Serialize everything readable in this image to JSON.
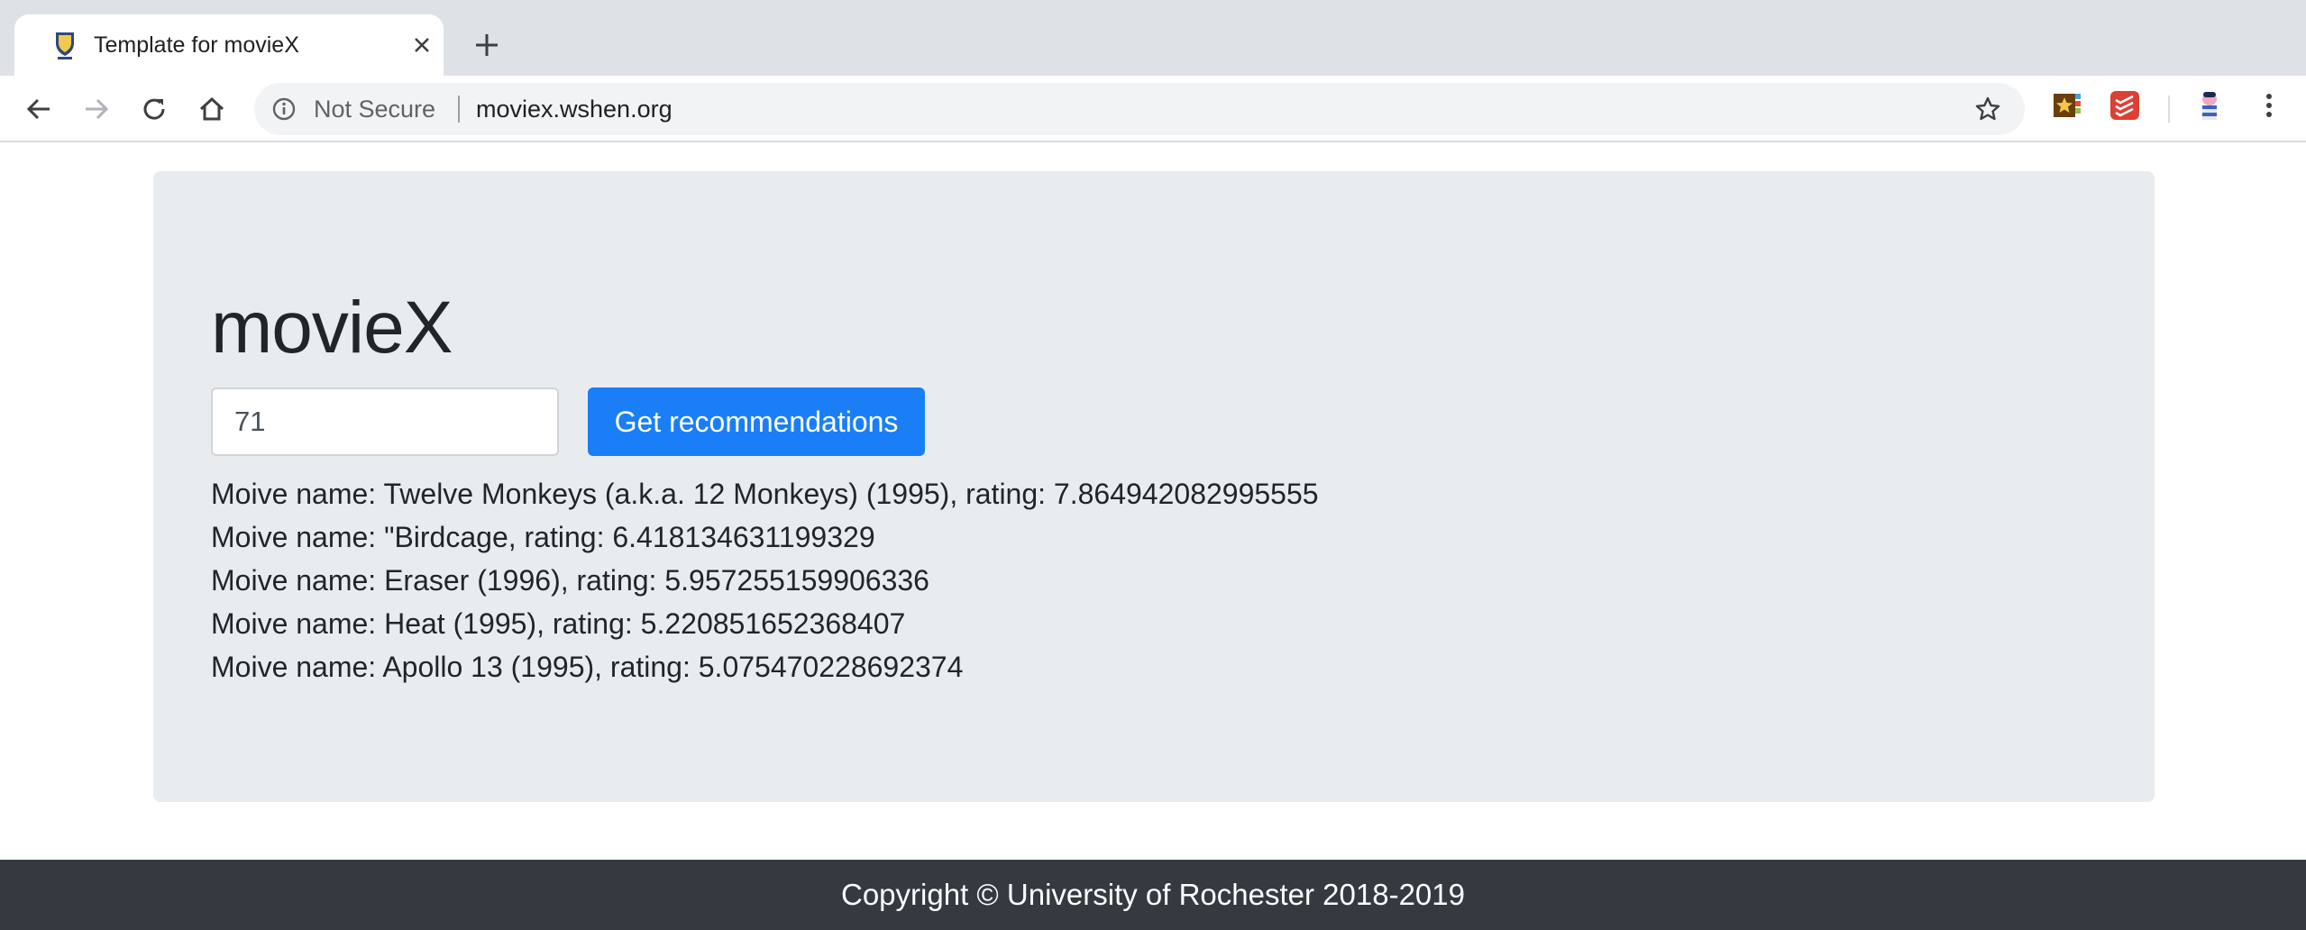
{
  "browser": {
    "tab_title": "Template for movieX",
    "security_label": "Not Secure",
    "url": "moviex.wshen.org"
  },
  "icons": {
    "tab_favicon": "university-shield-icon",
    "tab_close": "close-icon",
    "new_tab": "plus-icon",
    "back": "arrow-left-icon",
    "forward": "arrow-right-icon",
    "reload": "reload-icon",
    "home": "home-icon",
    "info": "info-circle-icon",
    "bookmark": "star-outline-icon",
    "extension_1": "star-badge-extension-icon",
    "extension_2": "todoist-extension-icon",
    "profile": "profile-avatar-icon",
    "menu": "kebab-menu-icon"
  },
  "page": {
    "title": "movieX",
    "input_value": "71",
    "button_label": "Get recommendations",
    "results": [
      "Moive name: Twelve Monkeys (a.k.a. 12 Monkeys) (1995), rating: 7.864942082995555",
      "Moive name: \"Birdcage, rating: 6.418134631199329",
      "Moive name: Eraser (1996), rating: 5.957255159906336",
      "Moive name: Heat (1995), rating: 5.220851652368407",
      "Moive name: Apollo 13 (1995), rating: 5.075470228692374"
    ],
    "footer": "Copyright © University of Rochester 2018-2019"
  },
  "colors": {
    "jumbotron_bg": "#e9ecef",
    "primary_button": "#1a7ff7",
    "footer_bg": "#343a40"
  }
}
